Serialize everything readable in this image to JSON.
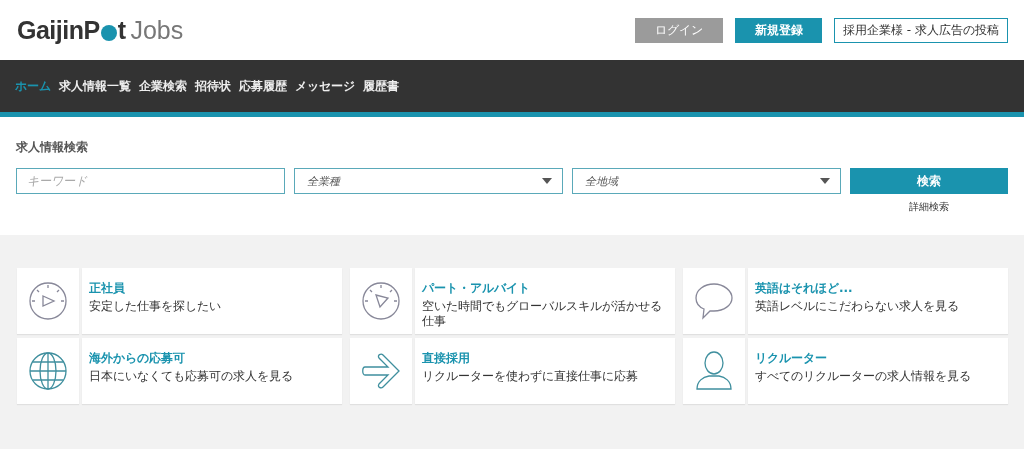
{
  "logo": {
    "part_1": "GaijinP",
    "part_2": "t",
    "suffix": "Jobs"
  },
  "header_buttons": [
    {
      "label": "ログイン",
      "kind": "muted"
    },
    {
      "label": "新規登録",
      "kind": "primary"
    },
    {
      "label": "採用企業様 - 求人広告の投稿",
      "kind": "outline"
    }
  ],
  "nav": [
    {
      "label": "ホーム",
      "selected": true
    },
    {
      "label": "求人情報一覧",
      "selected": false
    },
    {
      "label": "企業検索",
      "selected": false
    },
    {
      "label": "招待状",
      "selected": false
    },
    {
      "label": "応募履歴",
      "selected": false
    },
    {
      "label": "メッセージ",
      "selected": false
    },
    {
      "label": "履歴書",
      "selected": false
    }
  ],
  "search": {
    "title": "求人情報検索",
    "keyword": {
      "placeholder": "キーワード"
    },
    "category": {
      "value": "全業種"
    },
    "region": {
      "value": "全地域"
    },
    "button": "検索",
    "advanced_link": "詳細検索"
  },
  "categories": [
    {
      "kind": "gauge",
      "title": "正社員",
      "description": "安定した仕事を探したい"
    },
    {
      "kind": "gauge-tilted",
      "title": "パート・アルバイト",
      "description": "空いた時間でもグローバルスキルが活かせる仕事"
    },
    {
      "kind": "speech",
      "title": "英語はそれほど...",
      "description": "英語レベルにこだわらない求人を見る"
    },
    {
      "kind": "globe",
      "title": "海外からの応募可",
      "description": "日本にいなくても応募可の求人を見る"
    },
    {
      "kind": "arrow",
      "title": "直接採用",
      "description": "リクルーターを使わずに直接仕事に応募"
    },
    {
      "kind": "person",
      "title": "リクルーター",
      "description": "すべてのリクルーターの求人情報を見る"
    }
  ]
}
